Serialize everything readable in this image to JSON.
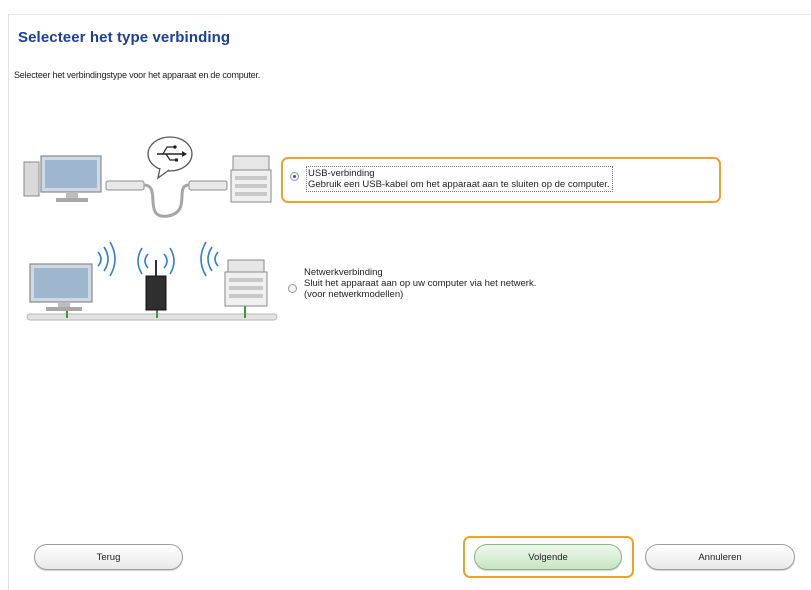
{
  "dialog": {
    "title": "Selecteer het type verbinding",
    "subtitle": "Selecteer het verbindingstype voor het apparaat en de computer."
  },
  "options": [
    {
      "id": "usb",
      "title": "USB-verbinding",
      "description": "Gebruik een USB-kabel om het apparaat aan te sluiten op de computer.",
      "selected": true,
      "highlighted": true
    },
    {
      "id": "network",
      "title": "Netwerkverbinding",
      "description": "Sluit het apparaat aan op uw computer via het netwerk.",
      "note": "(voor netwerkmodellen)",
      "selected": false,
      "highlighted": false
    }
  ],
  "buttons": {
    "back": "Terug",
    "next": "Volgende",
    "cancel": "Annuleren"
  },
  "colors": {
    "title": "#1a3f9c",
    "highlight": "#f0a12c",
    "next_button": "#c7e6c2",
    "network_device": "#3f9a3a"
  },
  "icons": [
    "computer-icon",
    "usb-cable-icon",
    "usb-symbol-icon",
    "printer-icon",
    "wifi-wave-icon",
    "wireless-router-icon"
  ]
}
